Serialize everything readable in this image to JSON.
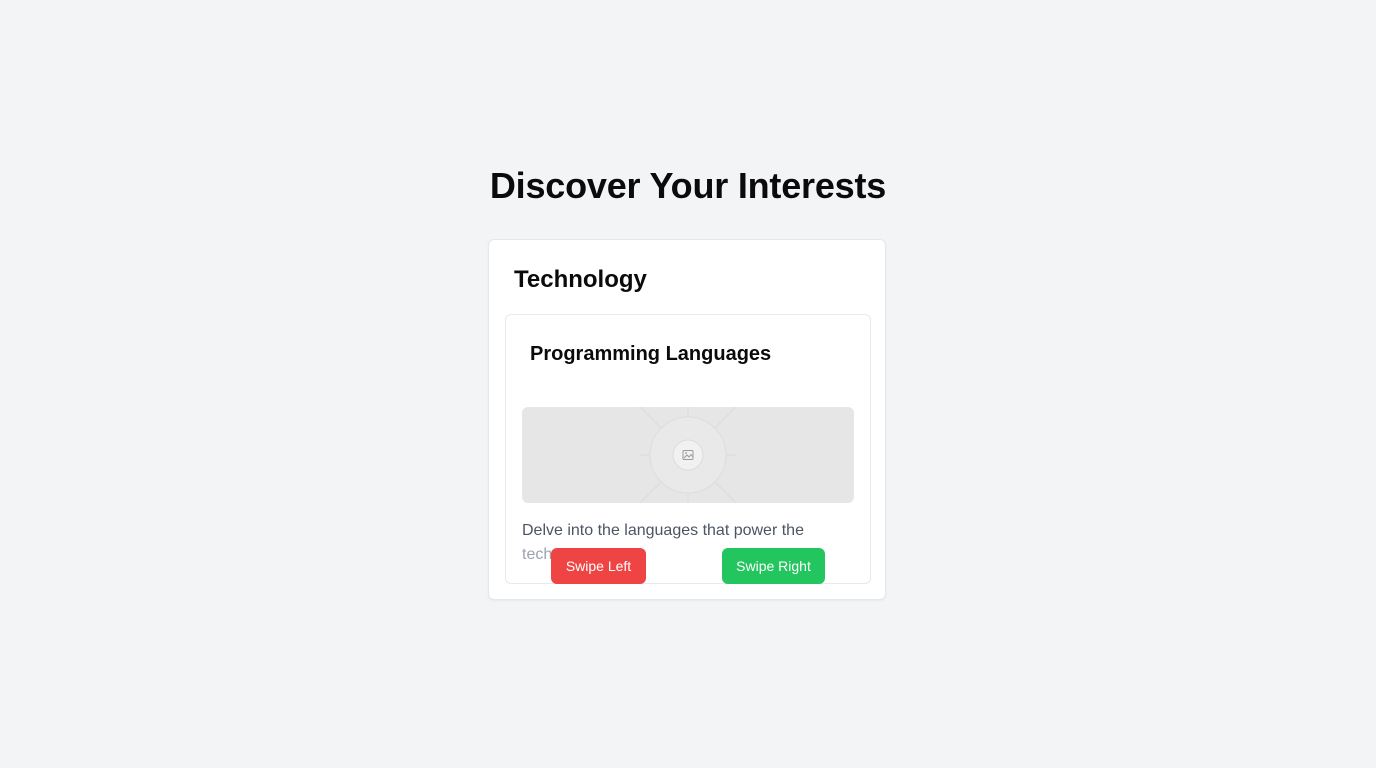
{
  "page": {
    "title": "Discover Your Interests"
  },
  "card": {
    "category": "Technology",
    "topic": {
      "title": "Programming Languages",
      "image_alt": "image-placeholder-icon",
      "description_line1": "Delve into the languages that power the",
      "description_line2": "tech"
    }
  },
  "actions": {
    "swipe_left_label": "Swipe Left",
    "swipe_right_label": "Swipe Right"
  },
  "colors": {
    "background": "#f3f4f6",
    "swipe_left": "#ef4444",
    "swipe_right": "#22c55e",
    "placeholder": "#e6e6e6"
  }
}
